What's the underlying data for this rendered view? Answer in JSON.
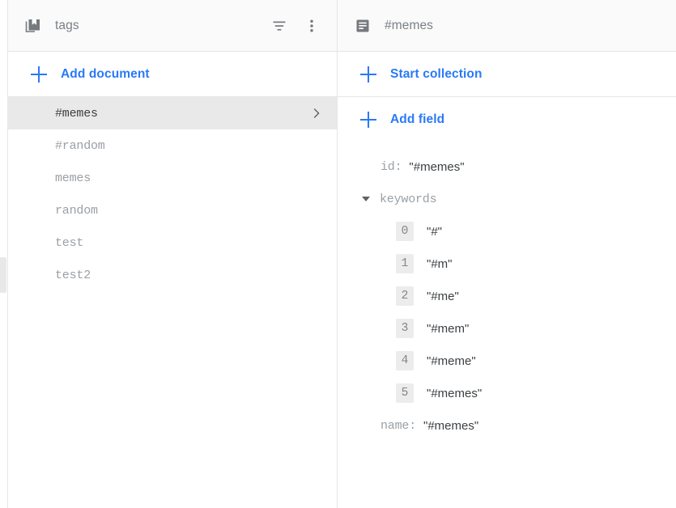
{
  "docs_panel": {
    "header": {
      "icon": "collection-icon",
      "title": "tags",
      "filter_icon": "filter-icon",
      "menu_icon": "more-vert-icon"
    },
    "add_action": {
      "icon": "plus-icon",
      "label": "Add document"
    },
    "documents": [
      {
        "label": "#memes",
        "selected": true
      },
      {
        "label": "#random",
        "selected": false
      },
      {
        "label": "memes",
        "selected": false
      },
      {
        "label": "random",
        "selected": false
      },
      {
        "label": "test",
        "selected": false
      },
      {
        "label": "test2",
        "selected": false
      }
    ],
    "chevron_icon": "chevron-right-icon"
  },
  "detail_panel": {
    "header": {
      "icon": "document-icon",
      "title": "#memes"
    },
    "start_collection": {
      "icon": "plus-icon",
      "label": "Start collection"
    },
    "add_field": {
      "icon": "plus-icon",
      "label": "Add field"
    },
    "fields": {
      "id_key": "id:",
      "id_value": "\"#memes\"",
      "keywords_key": "keywords",
      "keywords_expanded": true,
      "keywords": [
        {
          "index": "0",
          "value": "\"#\""
        },
        {
          "index": "1",
          "value": "\"#m\""
        },
        {
          "index": "2",
          "value": "\"#me\""
        },
        {
          "index": "3",
          "value": "\"#mem\""
        },
        {
          "index": "4",
          "value": "\"#meme\""
        },
        {
          "index": "5",
          "value": "\"#memes\""
        }
      ],
      "name_key": "name:",
      "name_value": "\"#memes\""
    }
  },
  "colors": {
    "accent": "#2979f7",
    "selected_row": "#e9e9e9",
    "header_bg": "#fafafa",
    "border": "#e4e6e8",
    "muted_text": "#9aa0a6",
    "primary_text": "#3c4043"
  }
}
